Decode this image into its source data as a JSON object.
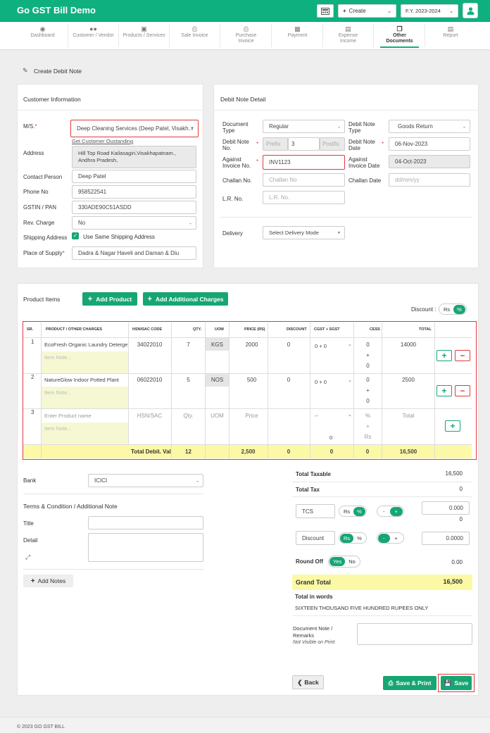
{
  "app": {
    "title": "Go GST Bill Demo"
  },
  "topbar": {
    "create_label": "Create",
    "fy_label": "F.Y. 2023-2024"
  },
  "nav": [
    {
      "label": "Dashboard"
    },
    {
      "label": "Customer / Vendor"
    },
    {
      "label": "Products / Services"
    },
    {
      "label": "Sale Invoice"
    },
    {
      "label": "Purchase Invoice"
    },
    {
      "label": "Payment"
    },
    {
      "label": "Expense Income"
    },
    {
      "label": "Other Documents"
    },
    {
      "label": "Report"
    }
  ],
  "page": {
    "title": "Create Debit Note"
  },
  "customer": {
    "heading": "Customer Information",
    "ms_label": "M/S.",
    "ms_value": "Deep Cleaning Services (Deep Patel, Visakh...",
    "outstanding_link": "Get Customer Oustanding",
    "address_label": "Address",
    "address_value": "Hill Top Road Kailasagiri,Visakhapatnam., Andhra Pradesh,",
    "contact_label": "Contact Person",
    "contact_value": "Deep Patel",
    "phone_label": "Phone No",
    "phone_value": "958522541",
    "gstin_label": "GSTIN / PAN",
    "gstin_value": "330ADE90C51ASDD",
    "rev_label": "Rev. Charge",
    "rev_value": "No",
    "ship_label": "Shipping Address",
    "ship_check_label": "Use Same Shipping Address",
    "pos_label": "Place of Supply",
    "pos_value": "Dadra & Nagar Haveli and Daman & Diu"
  },
  "debit": {
    "heading": "Debit Note Detail",
    "doc_type_label": "Document Type",
    "doc_type_value": "Regular",
    "dn_type_label": "Debit Note Type",
    "dn_type_value": "Goods Return",
    "dn_no_label": "Debit Note No.",
    "prefix_ph": "Prefix",
    "dn_no_value": "3",
    "postfix_ph": "Postfix",
    "dn_date_label": "Debit Note Date",
    "dn_date_value": "06-Nov-2023",
    "against_inv_label": "Against Invoice No.",
    "against_inv_value": "INV1123",
    "against_date_label": "Against Invoice Date",
    "against_date_value": "04-Oct-2023",
    "challan_label": "Challan No.",
    "challan_ph": "Challan No",
    "challan_date_label": "Challan Date",
    "challan_date_ph": "dd/mm/yy",
    "lr_label": "L.R. No.",
    "lr_ph": "L.R. No.",
    "delivery_label": "Delivery",
    "delivery_value": "Select Delivery Mode"
  },
  "products": {
    "heading": "Product Items",
    "add_product": "Add Product",
    "add_charges": "Add Additional Charges",
    "discount_label": "Discount :",
    "toggle_rs": "Rs",
    "toggle_pct": "%",
    "columns": [
      "SR.",
      "PRODUCT / OTHER CHARGES",
      "HSN/SAC CODE",
      "QTY.",
      "UOM",
      "PRICE (RS)",
      "DISCOUNT",
      "CGST + SGST",
      "CESS",
      "TOTAL"
    ],
    "rows": [
      {
        "sr": "1",
        "name": "EcoFresh Organic Laundry Detergent",
        "note_ph": "Item Note...",
        "hsn": "34022010",
        "qty": "7",
        "uom": "KGS",
        "price": "2000",
        "discount": "0",
        "gst": "0 + 0",
        "cess_a": "0",
        "cess_plus": "+",
        "cess_b": "0",
        "total": "14000"
      },
      {
        "sr": "2",
        "name": "NatureGlow Indoor Potted Plant",
        "note_ph": "Item Note...",
        "hsn": "06022010",
        "qty": "5",
        "uom": "NOS",
        "price": "500",
        "discount": "0",
        "gst": "0 + 0",
        "cess_a": "0",
        "cess_plus": "+",
        "cess_b": "0",
        "total": "2500"
      }
    ],
    "new_row": {
      "sr": "3",
      "name_ph": "Enter Product name",
      "note_ph": "Item Note...",
      "hsn_ph": "HSN/SAC",
      "qty_ph": "Qty.",
      "uom_ph": "UOM",
      "price_ph": "Price",
      "gst_ph": "--",
      "gst_zero": "0",
      "cess_a": "%",
      "cess_plus": "+",
      "cess_b": "Rs",
      "total_ph": "Total"
    },
    "footer": {
      "label": "Total Debit. Val",
      "qty": "12",
      "price": "2,500",
      "discount": "0",
      "gst": "0",
      "cess": "0",
      "total": "16,500"
    }
  },
  "bank": {
    "label": "Bank",
    "value": "ICICI"
  },
  "terms": {
    "heading": "Terms & Condition / Additional Note",
    "title_label": "Title",
    "detail_label": "Detail",
    "add_notes": "Add Notes"
  },
  "totals": {
    "taxable_label": "Total Taxable",
    "taxable_value": "16,500",
    "tax_label": "Total Tax",
    "tax_value": "0",
    "tcs_label": "TCS",
    "tcs_rs": "Rs",
    "tcs_pct": "%",
    "tcs_minus": "-",
    "tcs_plus": "+",
    "tcs_value": "0.000",
    "tcs_amount": "0",
    "disc_label": "Discount",
    "disc_rs": "Rs",
    "disc_pct": "%",
    "disc_minus": "-",
    "disc_plus": "+",
    "disc_value": "0.0000",
    "round_label": "Round Off",
    "round_yes": "Yes",
    "round_no": "No",
    "round_value": "0.00",
    "grand_label": "Grand Total",
    "grand_value": "16,500",
    "words_label": "Total in words",
    "words_value": "SIXTEEN THOUSAND FIVE HUNDRED RUPEES ONLY",
    "doc_note_label": "Document Note / Remarks",
    "doc_note_sub": "Not Visible on Print"
  },
  "actions": {
    "back": "Back",
    "save_print": "Save & Print",
    "save": "Save"
  },
  "footer": {
    "copyright": "© 2023 GO GST BILL"
  },
  "colors": {
    "accent": "#0fb07f",
    "danger": "#e0393e",
    "highlight": "#fbf9a6"
  }
}
